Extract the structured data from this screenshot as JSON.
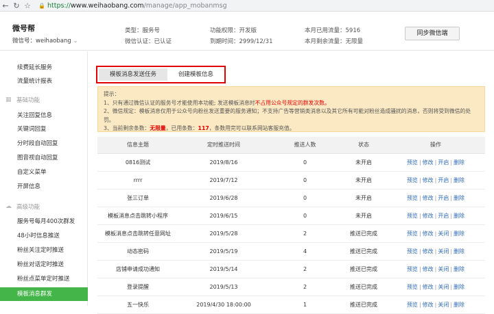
{
  "browser": {
    "url_scheme": "https://",
    "url_host": "www.weihaobang.com",
    "url_path": "/manage/app_mobanmsg"
  },
  "header": {
    "brand": "微号帮",
    "wxid_label": "微信号：",
    "wxid_value": "weihaobang",
    "type": "类型：服务号",
    "verify": "微信认证：已认证",
    "perm": "功能权限：开发版",
    "expire": "到期时间：2999/12/31",
    "used_flow": "本月已用流量：5916",
    "remain_flow": "本月剩余流量：无限量",
    "sync_button": "同步微信端"
  },
  "sidebar": {
    "items_top": [
      "续费延长服务",
      "流量统计报表"
    ],
    "group_basic": "基础功能",
    "items_basic": [
      "关注回复信息",
      "关键词回复",
      "分时段自动回复",
      "图音视自动回复",
      "自定义菜单",
      "开屏信息"
    ],
    "group_adv": "高级功能",
    "items_adv": [
      "服务号每月400次群发",
      "48小时信息推送",
      "粉丝关注定时推送",
      "粉丝对话定时推送",
      "粉丝点菜单定时推送",
      "模板消息群发"
    ]
  },
  "tabs": [
    "模板消息发送任务",
    "创建模板信息"
  ],
  "notice": {
    "title": "提示：",
    "line1_a": "1、只有通过微信认证的服务号才能使用本功能; 发送模板消息时",
    "line1_b": "不占用公众号规定的群发次数。",
    "line2": "2、微信规定：模板消息仅用于公众号向粉丝发送重要的服务通知；不支持广告等营销类消息以及其它所有可能对粉丝造成骚扰的消息，否则将受到微信的处罚。",
    "line3_a": "3、当前剩余条数：",
    "line3_b": "无限量",
    "line3_c": "，已用条数：",
    "line3_d": "117",
    "line3_e": "，条数用完可以联系网站客服充值。"
  },
  "table": {
    "headers": [
      "信息主题",
      "定时推送时间",
      "推送人数",
      "状态",
      "操作"
    ],
    "rows": [
      {
        "topic": "0816测试",
        "time": "2019/8/16",
        "count": "0",
        "status": "未开启",
        "ops": [
          "预览",
          "修改",
          "开启",
          "删除"
        ]
      },
      {
        "topic": "rrrr",
        "time": "2019/7/12",
        "count": "0",
        "status": "未开启",
        "ops": [
          "预览",
          "修改",
          "开启",
          "删除"
        ]
      },
      {
        "topic": "张三订单",
        "time": "2019/6/28",
        "count": "0",
        "status": "未开启",
        "ops": [
          "预览",
          "修改",
          "开启",
          "删除"
        ]
      },
      {
        "topic": "模板消息点击跳转小程序",
        "time": "2019/6/15",
        "count": "0",
        "status": "未开启",
        "ops": [
          "预览",
          "修改",
          "开启",
          "删除"
        ]
      },
      {
        "topic": "模板消息点击跳转任意网址",
        "time": "2019/5/28",
        "count": "2",
        "status": "推送已完成",
        "ops": [
          "预览",
          "修改",
          "关闭",
          "删除"
        ]
      },
      {
        "topic": "动态密码",
        "time": "2019/5/19",
        "count": "4",
        "status": "推送已完成",
        "ops": [
          "预览",
          "修改",
          "关闭",
          "删除"
        ]
      },
      {
        "topic": "店铺申请成功通知",
        "time": "2019/5/14",
        "count": "2",
        "status": "推送已完成",
        "ops": [
          "预览",
          "修改",
          "关闭",
          "删除"
        ]
      },
      {
        "topic": "登录提醒",
        "time": "2019/5/13",
        "count": "2",
        "status": "推送已完成",
        "ops": [
          "预览",
          "修改",
          "关闭",
          "删除"
        ]
      },
      {
        "topic": "五一快乐",
        "time": "2019/4/30 18:00:00",
        "count": "1",
        "status": "推送已完成",
        "ops": [
          "预览",
          "修改",
          "关闭",
          "删除"
        ]
      }
    ]
  },
  "colors": {
    "accent_green": "#44b549",
    "alert_red": "#e00000",
    "done_orange": "#d39400",
    "link_blue": "#2d6bb3",
    "notice_bg": "#fbe9c3"
  }
}
